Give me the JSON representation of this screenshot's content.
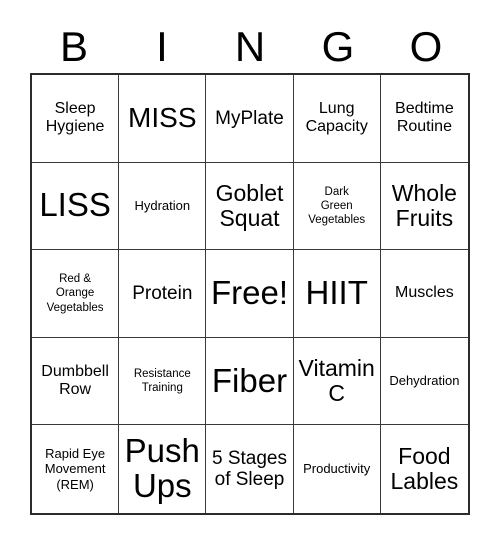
{
  "card": {
    "title_letters": [
      "B",
      "I",
      "N",
      "G",
      "O"
    ],
    "columns": 5,
    "rows": 5,
    "free_space_index": 12,
    "colors": {
      "background": "#ffffff",
      "text": "#000000",
      "grid_border_outer": "#2b2b2b",
      "grid_border_inner": "#3a3a3a"
    },
    "cells": [
      {
        "text": "Sleep\nHygiene",
        "size": "sz-m"
      },
      {
        "text": "MISS",
        "size": "sz-xxl"
      },
      {
        "text": "MyPlate",
        "size": "sz-l"
      },
      {
        "text": "Lung\nCapacity",
        "size": "sz-m"
      },
      {
        "text": "Bedtime\nRoutine",
        "size": "sz-m"
      },
      {
        "text": "LISS",
        "size": "sz-3xl"
      },
      {
        "text": "Hydration",
        "size": "sz-s"
      },
      {
        "text": "Goblet\nSquat",
        "size": "sz-xl"
      },
      {
        "text": "Dark\nGreen\nVegetables",
        "size": "sz-xs"
      },
      {
        "text": "Whole\nFruits",
        "size": "sz-xl"
      },
      {
        "text": "Red &\nOrange\nVegetables",
        "size": "sz-xs"
      },
      {
        "text": "Protein",
        "size": "sz-l"
      },
      {
        "text": "Free!",
        "size": "sz-3xl"
      },
      {
        "text": "HIIT",
        "size": "sz-3xl"
      },
      {
        "text": "Muscles",
        "size": "sz-m"
      },
      {
        "text": "Dumbbell\nRow",
        "size": "sz-m"
      },
      {
        "text": "Resistance\nTraining",
        "size": "sz-xs"
      },
      {
        "text": "Fiber",
        "size": "sz-3xl"
      },
      {
        "text": "Vitamin\nC",
        "size": "sz-xl"
      },
      {
        "text": "Dehydration",
        "size": "sz-s"
      },
      {
        "text": "Rapid Eye\nMovement\n(REM)",
        "size": "sz-s"
      },
      {
        "text": "Push\nUps",
        "size": "sz-3xl"
      },
      {
        "text": "5 Stages\nof Sleep",
        "size": "sz-l"
      },
      {
        "text": "Productivity",
        "size": "sz-s"
      },
      {
        "text": "Food\nLables",
        "size": "sz-xl"
      }
    ]
  }
}
